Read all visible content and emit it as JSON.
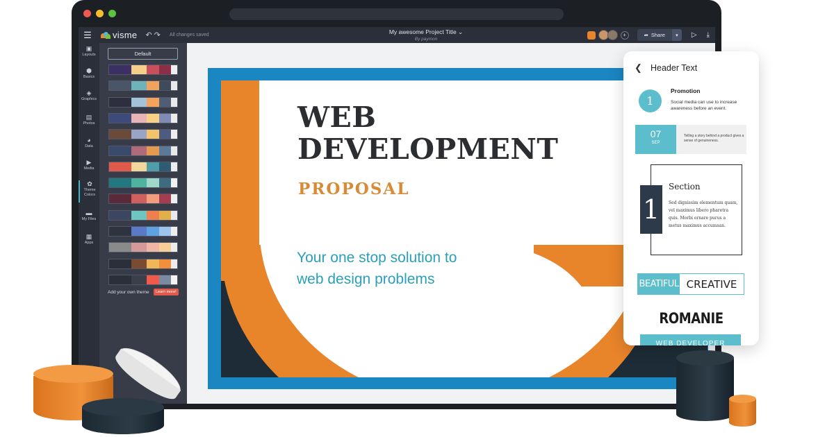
{
  "app": {
    "brand": "visme",
    "save_status": "All changes saved",
    "project_title": "My awesome Project Title",
    "project_by": "By paymon",
    "share_label": "Share"
  },
  "icons": {
    "menu": "menu-icon",
    "undo": "undo-icon",
    "redo": "redo-icon",
    "play": "play-icon",
    "download": "download-icon",
    "share": "share-icon",
    "back": "chevron-left-icon"
  },
  "rail": {
    "items": [
      {
        "label": "Layouts"
      },
      {
        "label": "Basics"
      },
      {
        "label": "Graphics"
      },
      {
        "label": "Photos"
      },
      {
        "label": "Data"
      },
      {
        "label": "Media"
      },
      {
        "label": "Theme Colors"
      },
      {
        "label": "My Files"
      },
      {
        "label": "Apps"
      }
    ],
    "active": "Theme Colors"
  },
  "theme_panel": {
    "default_label": "Default",
    "palettes": [
      [
        "#3b2f63",
        "#f3cf8a",
        "#c94f5d",
        "#8c2f46",
        "#eeeeee"
      ],
      [
        "#4a5568",
        "#6fb3b8",
        "#f0a35e",
        "#3f4a5a",
        "#e9e9e9"
      ],
      [
        "#2d2f3f",
        "#a3c3d9",
        "#f5a25d",
        "#4f5d75",
        "#eaeaea"
      ],
      [
        "#3d4a7a",
        "#e8b4b8",
        "#f6d186",
        "#7d8bb5",
        "#ececec"
      ],
      [
        "#6b4a3a",
        "#9aa5c6",
        "#f2c36b",
        "#4e5b80",
        "#eeeeee"
      ],
      [
        "#3a4a6b",
        "#b06b7a",
        "#e59a4f",
        "#5b7a9a",
        "#e8e8e8"
      ],
      [
        "#e05a4c",
        "#f2d79b",
        "#4f9da6",
        "#2f5b75",
        "#ededed"
      ],
      [
        "#23777f",
        "#4fb3a0",
        "#9fd8cb",
        "#3f6b80",
        "#f1f1f1"
      ],
      [
        "#5a2a3a",
        "#d0605e",
        "#f29e7c",
        "#a43d4f",
        "#efefef"
      ],
      [
        "#3c4660",
        "#6fc6c0",
        "#f07f4e",
        "#e2b04a",
        "#eaeaea"
      ],
      [
        "#2e3340",
        "#5a7ac7",
        "#5fa2e0",
        "#9ec4ee",
        "#eeeeee"
      ],
      [
        "#8a8a8a",
        "#d49a9a",
        "#efb6a5",
        "#f5cf9a",
        "#ededed"
      ],
      [
        "#2b2f3a",
        "#7a4b30",
        "#f0b65a",
        "#f28e3c",
        "#ececec"
      ],
      [
        "#2b2f3a",
        "#3b3f4a",
        "#f15a4a",
        "#7a8aa0",
        "#f3f3f3"
      ]
    ],
    "add_theme_text": "Add your own theme",
    "learn_more": "Learn more!"
  },
  "slide": {
    "title_line1": "WEB",
    "title_line2": "DEVELOPMENT",
    "subtitle": "PROPOSAL",
    "tagline_line1": "Your one stop solution to",
    "tagline_line2": "web design problems"
  },
  "phone": {
    "header": "Header Text",
    "promo_number": "1",
    "promo_title": "Promotion",
    "promo_text": "Social media can use to increase awareness before an event.",
    "date_day": "07",
    "date_month": "SEP",
    "date_text": "Telling a story behind a product gives a sense of genuineness.",
    "section_number": "1",
    "section_title": "Section",
    "section_text": "Sed dignissim elementum quam, vel maximus libero pharetra quis. Morbi ornare purus a metus maximus accumsan.",
    "badge_left": "BEATIFUL",
    "badge_right": "CREATIVE",
    "romanie": "ROMANIE",
    "web_dev_cut": "WEB DEVELOPER"
  },
  "colors": {
    "accent_teal": "#5cbecd",
    "accent_orange": "#e8842a",
    "slide_blue": "#1a86c2",
    "dark_navy": "#1d2c36",
    "ui_dark": "#2a2f3a"
  }
}
